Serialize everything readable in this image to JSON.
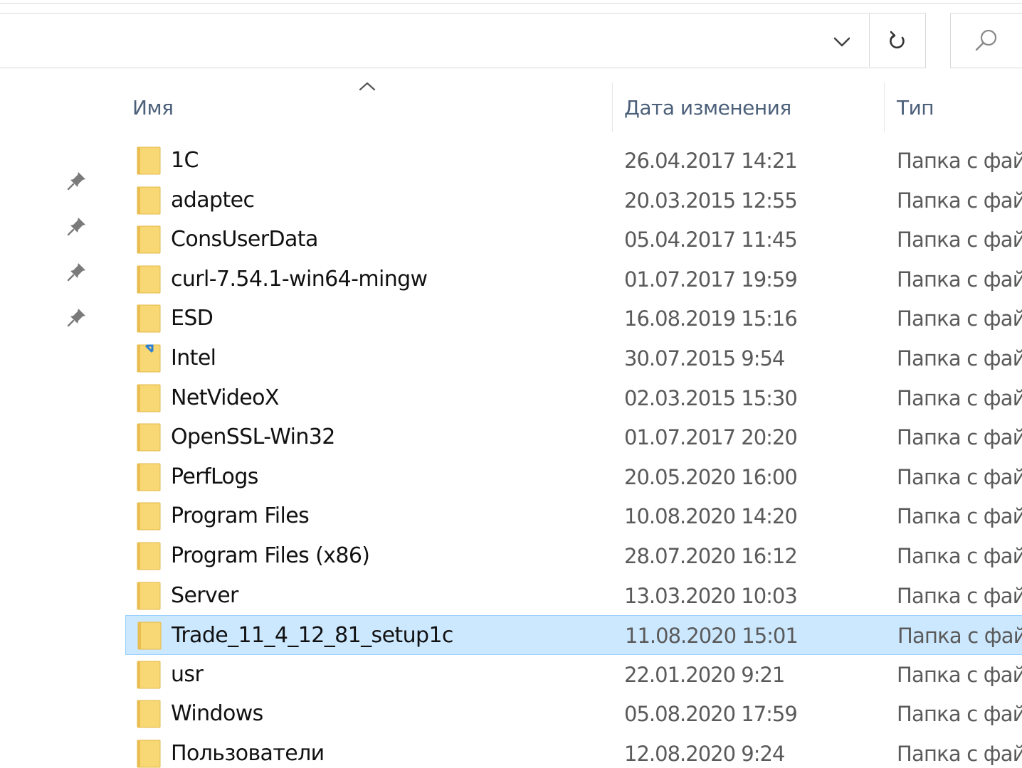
{
  "toolbar": {
    "dropdown_icon": "chevron-down-icon",
    "refresh_icon": "refresh-icon",
    "search_icon": "search-icon"
  },
  "columns": {
    "name": "Имя",
    "date": "Дата изменения",
    "type": "Тип",
    "sorted_by": "name",
    "sort_direction": "ascending"
  },
  "quick_access_pins": 4,
  "colors": {
    "folder": "#f8d775",
    "selection_bg": "#cce8ff",
    "selection_border": "#99d1ff",
    "header_text": "#4c607a"
  },
  "files": [
    {
      "name": "1C",
      "date": "26.04.2017 14:21",
      "type": "Папка с фай",
      "selected": false
    },
    {
      "name": "adaptec",
      "date": "20.03.2015 12:55",
      "type": "Папка с фай",
      "selected": false
    },
    {
      "name": "ConsUserData",
      "date": "05.04.2017 11:45",
      "type": "Папка с фай",
      "selected": false
    },
    {
      "name": "curl-7.54.1-win64-mingw",
      "date": "01.07.2017 19:59",
      "type": "Папка с фай",
      "selected": false
    },
    {
      "name": "ESD",
      "date": "16.08.2019 15:16",
      "type": "Папка с фай",
      "selected": false
    },
    {
      "name": "Intel",
      "date": "30.07.2015 9:54",
      "type": "Папка с фай",
      "selected": false,
      "shortcut": true
    },
    {
      "name": "NetVideoX",
      "date": "02.03.2015 15:30",
      "type": "Папка с фай",
      "selected": false
    },
    {
      "name": "OpenSSL-Win32",
      "date": "01.07.2017 20:20",
      "type": "Папка с фай",
      "selected": false
    },
    {
      "name": "PerfLogs",
      "date": "20.05.2020 16:00",
      "type": "Папка с фай",
      "selected": false
    },
    {
      "name": "Program Files",
      "date": "10.08.2020 14:20",
      "type": "Папка с фай",
      "selected": false
    },
    {
      "name": "Program Files (x86)",
      "date": "28.07.2020 16:12",
      "type": "Папка с фай",
      "selected": false
    },
    {
      "name": "Server",
      "date": "13.03.2020 10:03",
      "type": "Папка с фай",
      "selected": false
    },
    {
      "name": "Trade_11_4_12_81_setup1c",
      "date": "11.08.2020 15:01",
      "type": "Папка с фай",
      "selected": true
    },
    {
      "name": "usr",
      "date": "22.01.2020 9:21",
      "type": "Папка с фай",
      "selected": false
    },
    {
      "name": "Windows",
      "date": "05.08.2020 17:59",
      "type": "Папка с фай",
      "selected": false
    },
    {
      "name": "Пользователи",
      "date": "12.08.2020 9:24",
      "type": "Папка с фай",
      "selected": false
    }
  ]
}
